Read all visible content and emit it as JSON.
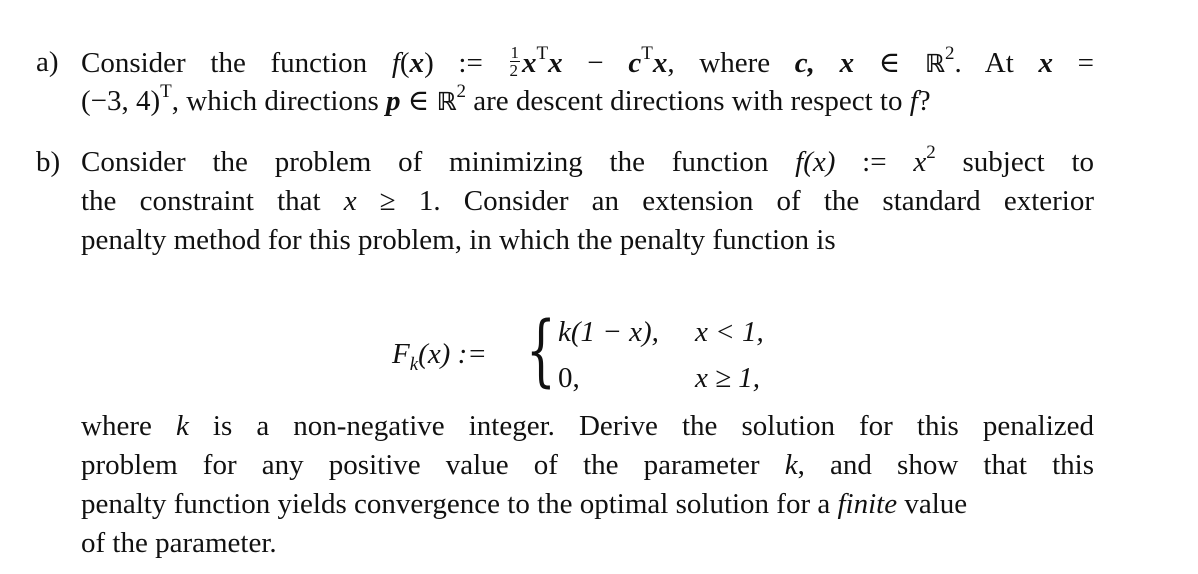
{
  "part_a": {
    "label": "a)",
    "line1": {
      "t1": "Consider the function ",
      "f": "f",
      "x": "x",
      "assign": " := ",
      "frac_num": "1",
      "frac_den": "2",
      "T": "T",
      "minus": " − ",
      "c": "c",
      "t2": ", where ",
      "cx": "c, x",
      "in": " ∈ ",
      "R": "ℝ",
      "sq": "2",
      "t3": ".  At ",
      "eq": " ="
    },
    "line2": {
      "vec": "(−3, 4)",
      "T": "T",
      "t1": ", which directions ",
      "p": "p",
      "in": " ∈ ",
      "R": "ℝ",
      "sq": "2",
      "t2": " are descent directions with respect to ",
      "f": "f",
      "q": "?"
    }
  },
  "part_b": {
    "label": "b)",
    "lines": [
      {
        "pre": "Consider the problem of minimizing the function ",
        "f": "f",
        "arg": "(x)",
        "assign": " := ",
        "x": "x",
        "sq": "2",
        "post": " subject to"
      },
      {
        "pre": "the constraint that ",
        "x": "x",
        "rel": " ≥ 1. ",
        "post": "Consider an extension of the standard exterior"
      },
      {
        "text": "penalty method for this problem, in which the penalty function is"
      }
    ],
    "display": {
      "F": "F",
      "sub_k": "k",
      "arg": "(x) :=",
      "brace": "{",
      "case1_expr": "k(1 − x),",
      "case1_cond": "x < 1,",
      "case2_expr": "0,",
      "case2_cond": "x ≥ 1,"
    },
    "after": [
      {
        "pre": "where ",
        "k": "k",
        "post": " is a non-negative integer.  Derive the solution for this penalized"
      },
      {
        "pre": "problem for any positive value of the parameter ",
        "k": "k",
        "post": ", and show that this"
      },
      {
        "pre": "penalty function yields convergence to the optimal solution for a ",
        "em": "finite",
        "post": " value"
      },
      {
        "text": "of the parameter."
      }
    ]
  }
}
